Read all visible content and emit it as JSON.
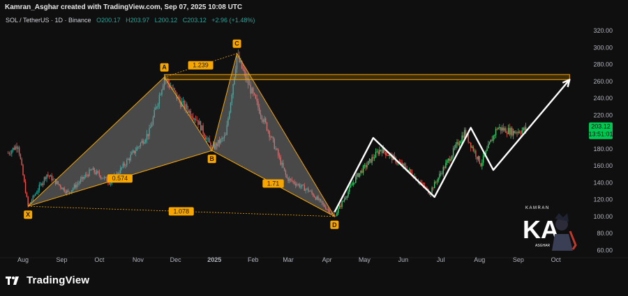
{
  "credit": "Kamran_Asghar created with TradingView.com, Sep 07, 2025 10:08 UTC",
  "legend": {
    "symbol": "SOL / TetherUS · 1D · Binance",
    "open": "O200.17",
    "high": "H203.97",
    "low": "L200.12",
    "close": "C203.12",
    "change": "+2.96 (+1.48%)"
  },
  "price_tag": {
    "price": "203.12",
    "countdown": "13:51:01"
  },
  "footer": {
    "brand": "TradingView"
  },
  "watermark": {
    "top": "KAMRAN",
    "mark": "KA",
    "bottom": "ASGHAR"
  },
  "colors": {
    "bg": "#0f0f0f",
    "up": "#26a69a",
    "up_bright": "#3bd16f",
    "down": "#ef5350",
    "pattern": "#f7a600",
    "projection": "#ffffff",
    "price_tag": "#00c853"
  },
  "chart_data": {
    "type": "candlestick",
    "title": "SOL / TetherUS · 1D · Binance",
    "x_ticks": [
      "Aug",
      "Sep",
      "Oct",
      "Nov",
      "Dec",
      "2025",
      "Feb",
      "Mar",
      "Apr",
      "May",
      "Jun",
      "Jul",
      "Aug",
      "Sep",
      "Oct"
    ],
    "y_ticks": [
      60,
      80,
      100,
      120,
      140,
      160,
      180,
      200,
      220,
      240,
      260,
      280,
      300,
      320
    ],
    "y_tick_labels": [
      "60.00",
      "80.00",
      "100.00",
      "120.00",
      "140.00",
      "160.00",
      "180.00",
      "200.00",
      "220.00",
      "240.00",
      "260.00",
      "280.00",
      "300.00",
      "320.00"
    ],
    "ylim": [
      60,
      330
    ],
    "scale": "linear",
    "price_path": [
      {
        "date": "2024-07-20",
        "price": 175
      },
      {
        "date": "2024-07-28",
        "price": 185
      },
      {
        "date": "2024-08-05",
        "price": 112
      },
      {
        "date": "2024-08-20",
        "price": 150
      },
      {
        "date": "2024-09-06",
        "price": 128
      },
      {
        "date": "2024-09-25",
        "price": 155
      },
      {
        "date": "2024-10-10",
        "price": 140
      },
      {
        "date": "2024-10-28",
        "price": 175
      },
      {
        "date": "2024-11-10",
        "price": 200
      },
      {
        "date": "2024-11-22",
        "price": 265
      },
      {
        "date": "2024-12-05",
        "price": 235
      },
      {
        "date": "2024-12-18",
        "price": 215
      },
      {
        "date": "2024-12-30",
        "price": 180
      },
      {
        "date": "2025-01-10",
        "price": 195
      },
      {
        "date": "2025-01-19",
        "price": 290
      },
      {
        "date": "2025-01-30",
        "price": 250
      },
      {
        "date": "2025-02-15",
        "price": 195
      },
      {
        "date": "2025-02-28",
        "price": 145
      },
      {
        "date": "2025-03-18",
        "price": 130
      },
      {
        "date": "2025-04-07",
        "price": 100
      },
      {
        "date": "2025-04-25",
        "price": 148
      },
      {
        "date": "2025-05-14",
        "price": 180
      },
      {
        "date": "2025-06-05",
        "price": 155
      },
      {
        "date": "2025-06-22",
        "price": 128
      },
      {
        "date": "2025-07-20",
        "price": 200
      },
      {
        "date": "2025-08-02",
        "price": 162
      },
      {
        "date": "2025-08-15",
        "price": 205
      },
      {
        "date": "2025-08-28",
        "price": 200
      },
      {
        "date": "2025-09-07",
        "price": 203
      }
    ],
    "harmonic_pattern": {
      "points": [
        {
          "label": "X",
          "date": "2024-08-05",
          "price": 112
        },
        {
          "label": "A",
          "date": "2024-11-22",
          "price": 265
        },
        {
          "label": "B",
          "date": "2024-12-30",
          "price": 178
        },
        {
          "label": "C",
          "date": "2025-01-19",
          "price": 293
        },
        {
          "label": "D",
          "date": "2025-04-07",
          "price": 100
        }
      ],
      "ratios": [
        {
          "label": "1.239",
          "between": [
            "A",
            "C"
          ]
        },
        {
          "label": "0.574",
          "between": [
            "X",
            "B"
          ]
        },
        {
          "label": "1.71",
          "between": [
            "B",
            "D"
          ]
        },
        {
          "label": "1.078",
          "between": [
            "X",
            "D"
          ]
        }
      ]
    },
    "resistance_zone": {
      "price_low": 262,
      "price_high": 268,
      "from": "2024-11-22",
      "to": "2025-10-12"
    },
    "projection_path": [
      {
        "date": "2025-04-07",
        "price": 105
      },
      {
        "date": "2025-05-08",
        "price": 193
      },
      {
        "date": "2025-06-26",
        "price": 123
      },
      {
        "date": "2025-07-25",
        "price": 205
      },
      {
        "date": "2025-08-12",
        "price": 155
      },
      {
        "date": "2025-10-12",
        "price": 262
      }
    ],
    "last_price": 203.12
  }
}
